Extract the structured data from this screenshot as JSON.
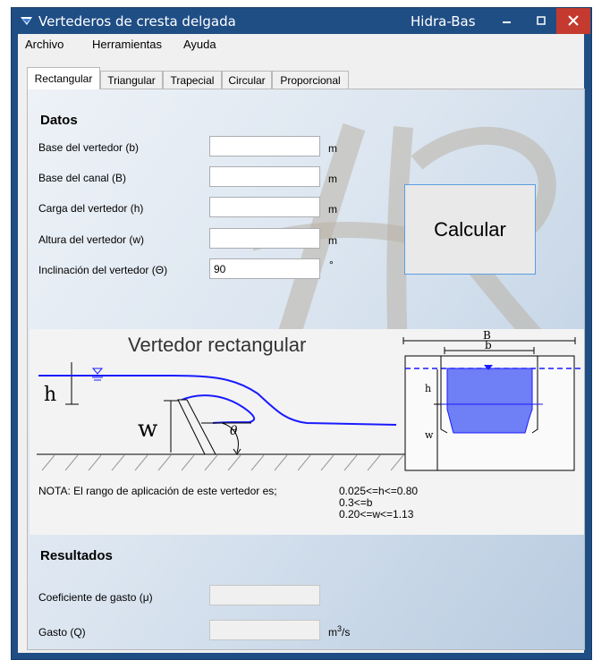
{
  "window": {
    "title": "Vertederos de cresta delgada",
    "app_name": "Hidra-Bas",
    "controls": [
      "minimize-icon",
      "maximize-icon",
      "close-icon"
    ]
  },
  "menu": {
    "items": [
      "Archivo",
      "Herramientas",
      "Ayuda"
    ]
  },
  "tabs": {
    "items": [
      "Rectangular",
      "Triangular",
      "Trapecial",
      "Circular",
      "Proporcional"
    ],
    "active": "Rectangular"
  },
  "datos": {
    "heading": "Datos",
    "fields": [
      {
        "label": "Base del vertedor (b)",
        "value": "",
        "unit": "m"
      },
      {
        "label": "Base del canal (B)",
        "value": "",
        "unit": "m"
      },
      {
        "label": "Carga del vertedor (h)",
        "value": "",
        "unit": "m"
      },
      {
        "label": "Altura del vertedor (w)",
        "value": "",
        "unit": "m"
      },
      {
        "label": "Inclinación del vertedor  (Θ)",
        "value": "90",
        "unit": "°"
      }
    ]
  },
  "calcular_label": "Calcular",
  "diagram": {
    "title": "Vertedor rectangular",
    "labels": {
      "h": "h",
      "w": "w",
      "theta": "θ",
      "B": "B",
      "b": "b",
      "h_front": "h",
      "w_front": "w"
    },
    "colors": {
      "water": "#1a1aff",
      "fill": "#6f7ff5"
    }
  },
  "nota": {
    "text": "NOTA: El rango de aplicación de este vertedor es;",
    "ranges": [
      "0.025<=h<=0.80",
      "0.3<=b",
      "0.20<=w<=1.13"
    ]
  },
  "resultados": {
    "heading": "Resultados",
    "fields": [
      {
        "label": "Coeficiente de gasto   (μ)",
        "value": "",
        "unit": ""
      },
      {
        "label": "Gasto (Q)",
        "value": "",
        "unit_base": "m",
        "unit_exp": "3",
        "unit_tail": "/s"
      }
    ]
  }
}
